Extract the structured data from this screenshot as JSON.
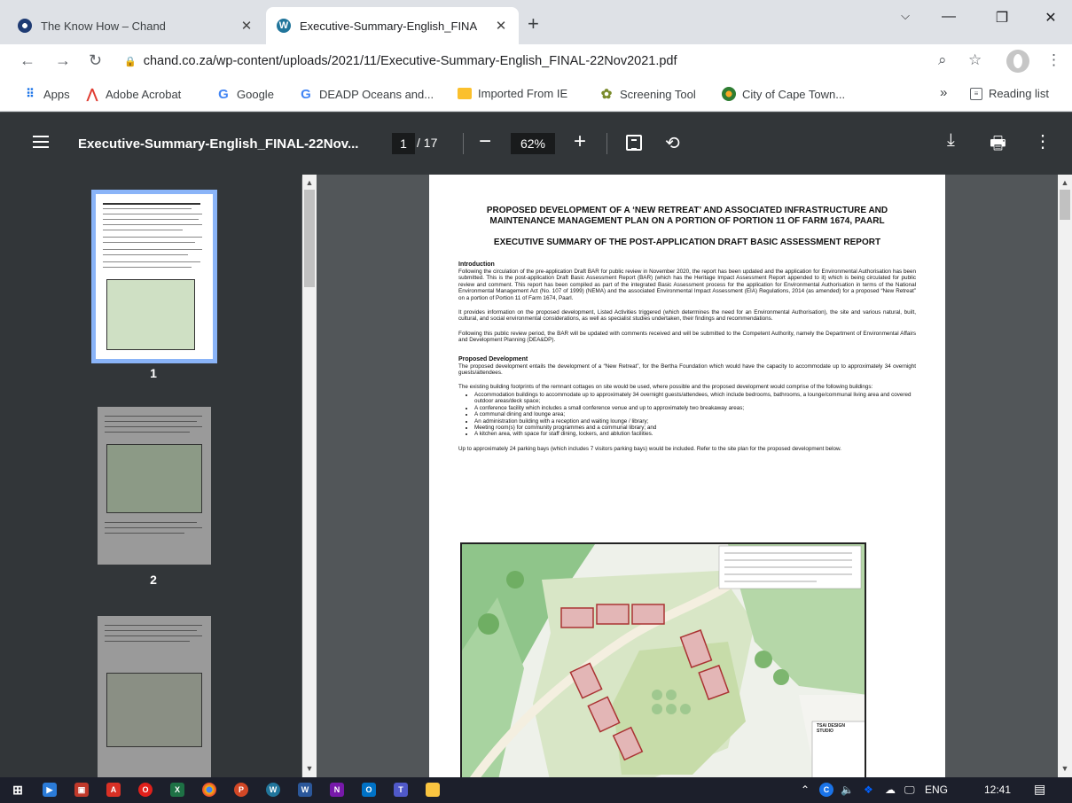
{
  "browser": {
    "tabs": [
      {
        "title": "The Know How – Chand",
        "active": false
      },
      {
        "title": "Executive-Summary-English_FINA",
        "active": true
      }
    ],
    "new_tab": "+",
    "url": "chand.co.za/wp-content/uploads/2021/11/Executive-Summary-English_FINAL-22Nov2021.pdf",
    "bookmarks": [
      "Apps",
      "Adobe Acrobat",
      "Google",
      "DEADP Oceans and...",
      "Imported From IE",
      "Screening Tool",
      "City of Cape Town..."
    ],
    "overflow": "»",
    "reading_list": "Reading list"
  },
  "pdf": {
    "title": "Executive-Summary-English_FINAL-22Nov...",
    "page_current": "1",
    "page_total": "/ 17",
    "zoom": "62%",
    "thumbnails": [
      "1",
      "2"
    ]
  },
  "document": {
    "title_line1": "PROPOSED DEVELOPMENT OF A ‘NEW RETREAT’ AND ASSOCIATED INFRASTRUCTURE AND",
    "title_line2": "MAINTENANCE MANAGEMENT PLAN ON A PORTION OF PORTION 11 OF FARM 1674, PAARL",
    "subtitle": "EXECUTIVE SUMMARY OF THE POST-APPLICATION DRAFT BASIC ASSESSMENT REPORT",
    "intro_heading": "Introduction",
    "intro_p1": "Following the circulation of the pre-application Draft BAR for public review in November 2020, the report has been updated and the application for Environmental Authorisation has been submitted.  This is the post-application Draft Basic Assessment Report (BAR) (which has the Heritage Impact Assessment Report appended to it) which is being circulated for public review and comment.  This report has been compiled as part of the integrated Basic Assessment process for  the application for Environmental Authorisation in terms of the National Environmental Management Act (No. 107 of 1999) (NEMA) and the associated Environmental Impact Assessment (EIA) Regulations, 2014 (as amended) for a proposed “New Retreat” on a portion of Portion 11 of Farm 1674, Paarl.",
    "intro_p2": "It provides information on the proposed development, Listed Activities triggered (which determines the need for an Environmental Authorisation), the site and various natural, built, cultural, and social environmental considerations, as well as specialist studies undertaken, their findings and recommendations.",
    "intro_p3": "Following this public review period, the BAR will be updated with comments received and will be submitted to the Competent Authority, namely the Department of Environmental Affairs and Development Planning (DEA&DP).",
    "dev_heading": "Proposed Development",
    "dev_p1": "The proposed development entails the development of a “New Retreat”, for the Bertha Foundation which would have the capacity to accommodate up to approximately 34 overnight guests/attendees.",
    "dev_p2": "The existing building footprints of the remnant cottages on site would be used, where possible and the proposed development would comprise of the following buildings:",
    "dev_list": [
      "Accommodation buildings to accommodate up to approximately 34 overnight guests/attendees, which include bedrooms, bathrooms, a lounge/communal living area and covered outdoor areas/deck space;",
      "A conference facility which includes a small conference venue and up to approximately two breakaway areas;",
      "A communal dining and lounge area;",
      "An administration building with a reception and waiting lounge / library;",
      "Meeting room(s) for community programmes and a communal library; and",
      "A kitchen area, with space for staff dining, lockers, and ablution facilities."
    ],
    "dev_p3": "Up to approximately 24 parking bays (which includes 7 visitors parking bays) would be included. Refer to the site plan for the proposed development below.",
    "map_label": "TSAI DESIGN STUDIO"
  },
  "taskbar": {
    "lang": "ENG",
    "time": "12:41"
  },
  "colors": {
    "accent": "#8ab4f8",
    "pdf_toolbar": "#323639",
    "pdf_background": "#525659"
  }
}
